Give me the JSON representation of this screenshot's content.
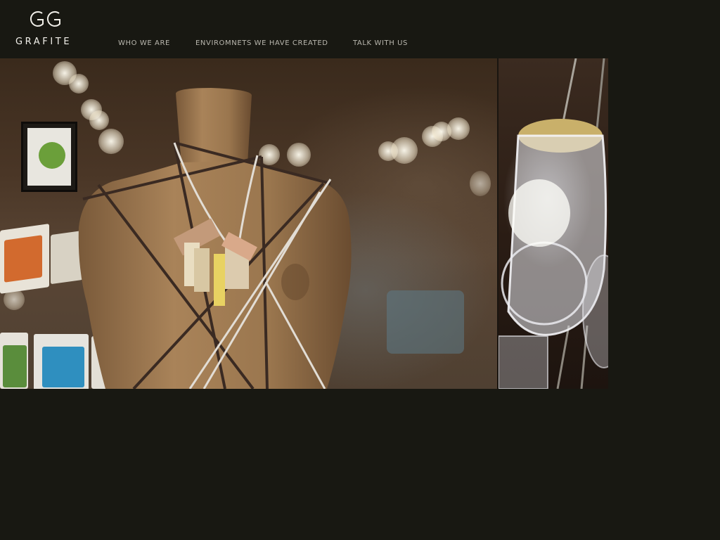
{
  "brand": {
    "monogram": "GG",
    "name": "GRAFITE"
  },
  "nav": {
    "items": [
      {
        "label": "WHO WE ARE"
      },
      {
        "label": "ENVIROMNETS WE HAVE CREATED"
      },
      {
        "label": "TALK WITH US"
      }
    ]
  },
  "gallery": {
    "main_photo_icon": "mannequin-photo",
    "side_photo_icon": "glass-jar-photo"
  },
  "colors": {
    "background": "#181812",
    "nav_text": "#b9b7ae",
    "logo": "#f2f0ea"
  }
}
